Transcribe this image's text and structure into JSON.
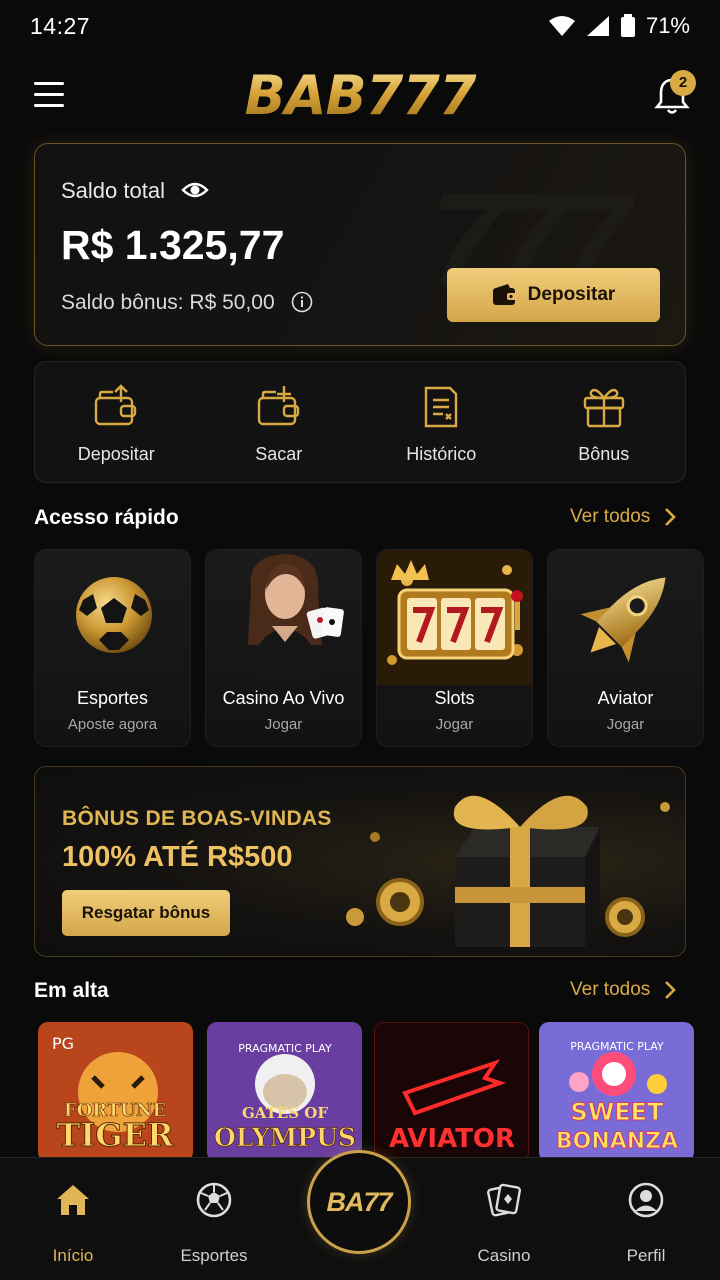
{
  "status_bar": {
    "time": "14:27",
    "battery": "71%"
  },
  "header": {
    "logo": "BAB777",
    "notification_count": "2"
  },
  "balance": {
    "label": "Saldo total",
    "amount": "R$ 1.325,77",
    "bonus_label": "Saldo bônus: R$ 50,00",
    "deposit_button": "Depositar",
    "watermark": "777"
  },
  "actions": [
    {
      "label": "Depositar",
      "icon": "wallet-in-icon"
    },
    {
      "label": "Sacar",
      "icon": "wallet-out-icon"
    },
    {
      "label": "Histórico",
      "icon": "history-icon"
    },
    {
      "label": "Bônus",
      "icon": "gift-icon"
    }
  ],
  "quick_access": {
    "title": "Acesso rápido",
    "see_all": "Ver todos",
    "tiles": [
      {
        "title": "Esportes",
        "subtitle": "Aposte agora"
      },
      {
        "title": "Casino Ao Vivo",
        "subtitle": "Jogar"
      },
      {
        "title": "Slots",
        "subtitle": "Jogar"
      },
      {
        "title": "Aviator",
        "subtitle": "Jogar"
      }
    ]
  },
  "promo": {
    "title": "BÔNUS DE BOAS-VINDAS",
    "subtitle": "100% ATÉ R$500",
    "button": "Resgatar bônus"
  },
  "trending": {
    "title": "Em alta",
    "see_all": "Ver todos",
    "games": [
      {
        "provider": "PG",
        "name_top": "FORTUNE",
        "name_bottom": "TIGER"
      },
      {
        "provider": "PRAGMATIC PLAY",
        "name_top": "GATES OF",
        "name_bottom": "OLYMPUS"
      },
      {
        "provider": "",
        "name_top": "",
        "name_bottom": "AVIATOR"
      },
      {
        "provider": "PRAGMATIC PLAY",
        "name_top": "SWEET",
        "name_bottom": "BONANZA"
      }
    ]
  },
  "bottom_nav": {
    "items": [
      {
        "label": "Início",
        "active": true
      },
      {
        "label": "Esportes",
        "active": false
      },
      {
        "label": "Casino",
        "active": false
      },
      {
        "label": "Perfil",
        "active": false
      }
    ],
    "center_label": "BA77"
  },
  "colors": {
    "gold": "#d9aa44",
    "background": "#0a0a0a"
  }
}
